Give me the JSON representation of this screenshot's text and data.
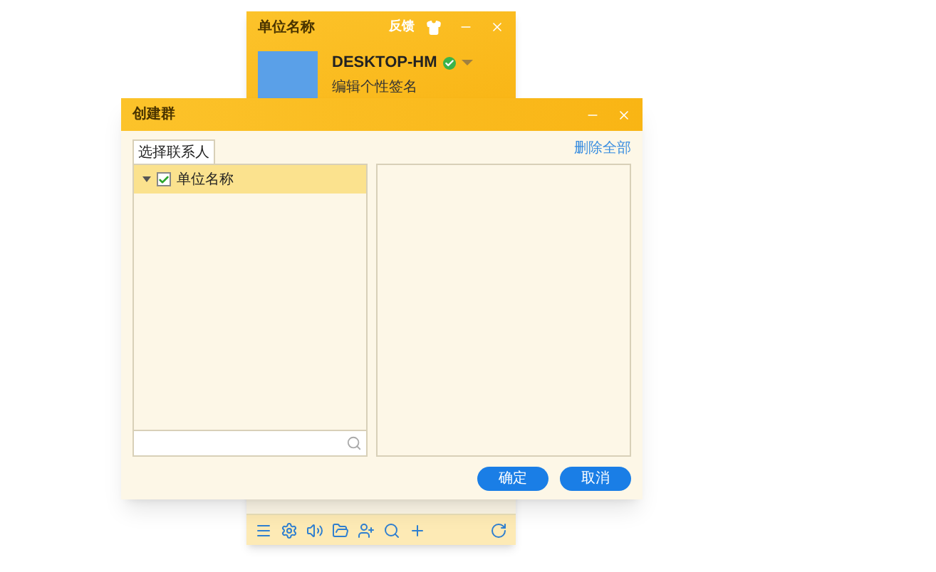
{
  "main_window": {
    "title": "单位名称",
    "feedback": "反馈",
    "user_name": "DESKTOP-HM",
    "online": true,
    "signature": "编辑个性签名"
  },
  "dialog": {
    "title": "创建群",
    "tabs": [
      {
        "label": "选择联系人",
        "selected": true
      }
    ],
    "remove_all": "删除全部",
    "tree": [
      {
        "label": "单位名称",
        "expanded": true,
        "checked": true,
        "selected": true
      }
    ],
    "buttons": [
      "确定",
      "取消"
    ]
  }
}
